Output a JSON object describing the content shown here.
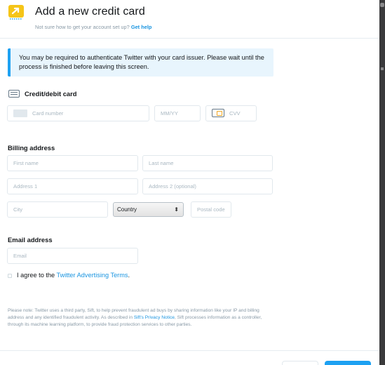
{
  "header": {
    "title": "Add a new credit card",
    "subtitle_text": "Not sure how to get your account set up?",
    "help_link": "Get help",
    "logo_icon": "twitter-ads-megaphone-icon"
  },
  "alert": {
    "text": "You may be required to authenticate Twitter with your card issuer. Please wait until the process is finished before leaving this screen."
  },
  "card_section": {
    "title": "Credit/debit card",
    "card_number_placeholder": "Card number",
    "expiry_placeholder": "MM/YY",
    "cvv_placeholder": "CVV"
  },
  "billing": {
    "title": "Billing address",
    "first_name_placeholder": "First name",
    "last_name_placeholder": "Last name",
    "address1_placeholder": "Address 1",
    "address2_placeholder": "Address 2 (optional)",
    "city_placeholder": "City",
    "country_selected": "Country",
    "postal_placeholder": "Postal code"
  },
  "email_section": {
    "title": "Email address",
    "email_placeholder": "Email"
  },
  "agree": {
    "prefix": "I agree to the",
    "link": "Twitter Advertising Terms",
    "suffix": "."
  },
  "note": {
    "part1": "Please note: Twitter uses a third party, Sift, to help prevent fraudulent ad buys by sharing information like your IP and billing address and any identified fraudulent activity. As described in",
    "link": "Sift's Privacy Notice",
    "part2": ", Sift processes information as a controller, through its machine learning platform, to provide fraud protection services to other parties."
  },
  "colors": {
    "accent": "#1da1f2",
    "link": "#1b95e0",
    "alert_bg": "#e8f5fd",
    "logo": "#f5c518"
  }
}
